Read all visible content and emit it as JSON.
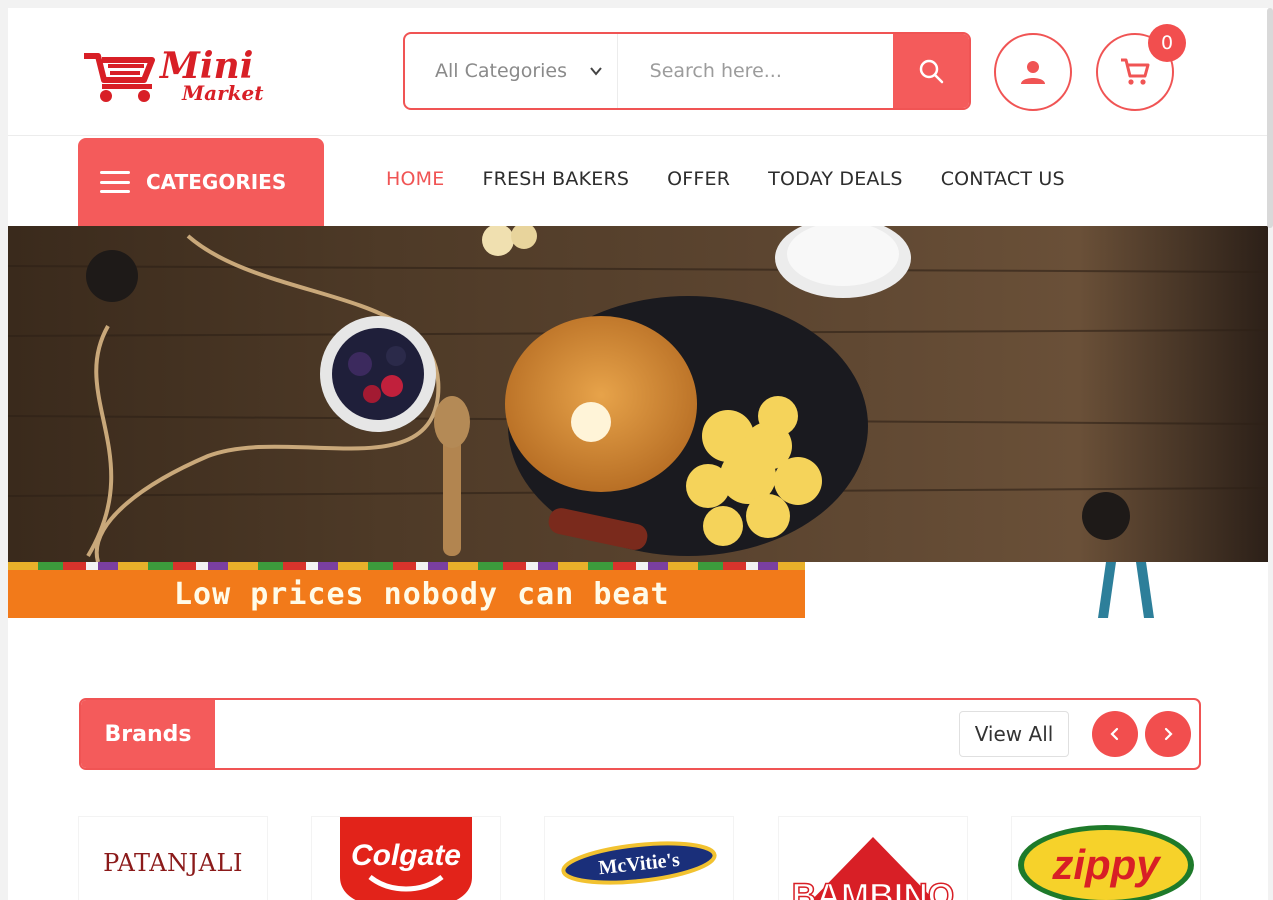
{
  "header": {
    "logo_line1": "Mini",
    "logo_line2": "Market",
    "search": {
      "category_label": "All Categories",
      "placeholder": "Search here..."
    },
    "cart_count": "0"
  },
  "nav": {
    "categories_label": "CATEGORIES",
    "items": [
      {
        "label": "HOME",
        "active": true
      },
      {
        "label": "FRESH BAKERS",
        "active": false
      },
      {
        "label": "OFFER",
        "active": false
      },
      {
        "label": "TODAY DEALS",
        "active": false
      },
      {
        "label": "CONTACT US",
        "active": false
      }
    ]
  },
  "hero": {
    "banner_text": "Low prices nobody can beat"
  },
  "brands": {
    "title": "Brands",
    "view_all_label": "View All",
    "logos": [
      {
        "name": "PATANJALI"
      },
      {
        "name": "Colgate"
      },
      {
        "name": "McVitie's"
      },
      {
        "name": "BAMBINO"
      },
      {
        "name": "zippy"
      }
    ]
  },
  "colors": {
    "accent": "#f45b5b",
    "banner": "#f27a1a",
    "nav_text": "#2d2d2d"
  },
  "icons": [
    "cart-logo-icon",
    "chevron-down-icon",
    "search-icon",
    "user-icon",
    "cart-icon",
    "hamburger-icon",
    "chevron-left-icon",
    "chevron-right-icon"
  ]
}
